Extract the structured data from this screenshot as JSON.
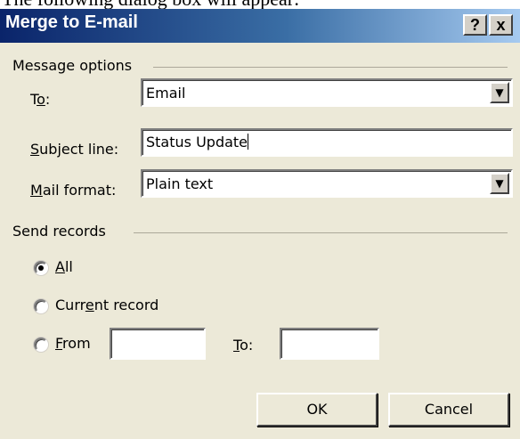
{
  "intro_text": "The following dialog box will appear:",
  "window": {
    "title": "Merge to E-mail",
    "help_glyph": "?",
    "close_glyph": "x"
  },
  "message_options": {
    "group_label": "Message options",
    "to": {
      "label_pre": "T",
      "label_u": "o",
      "label_post": ":",
      "value": "Email"
    },
    "subject": {
      "label_pre": "",
      "label_u": "S",
      "label_post": "ubject line:",
      "value": "Status Update"
    },
    "mail_format": {
      "label_pre": "",
      "label_u": "M",
      "label_post": "ail format:",
      "value": "Plain text"
    }
  },
  "send_records": {
    "group_label": "Send records",
    "all": {
      "label_pre": "",
      "label_u": "A",
      "label_post": "ll",
      "checked": true
    },
    "current": {
      "label_pre": "Curr",
      "label_u": "e",
      "label_post": "nt record",
      "checked": false
    },
    "from": {
      "label_pre": "",
      "label_u": "F",
      "label_post": "rom",
      "checked": false,
      "value": ""
    },
    "to": {
      "label_pre": "",
      "label_u": "T",
      "label_post": "o:",
      "value": ""
    }
  },
  "buttons": {
    "ok": "OK",
    "cancel": "Cancel"
  },
  "icons": {
    "dropdown_arrow": "dropdown-arrow-icon"
  },
  "colors": {
    "title_gradient_start": "#0a246a",
    "title_gradient_end": "#a6caf0",
    "dialog_bg": "#ece9d8"
  }
}
